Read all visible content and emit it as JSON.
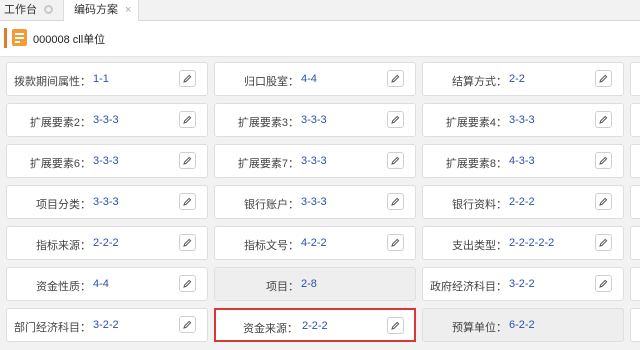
{
  "tabs": [
    {
      "label": "工作台"
    },
    {
      "label": "编码方案",
      "close": "×"
    }
  ],
  "header": {
    "title": "000008 cll单位"
  },
  "rows": [
    [
      {
        "label": "拨款期间属性：",
        "value": "1-1",
        "editable": true
      },
      {
        "label": "归口股室：",
        "value": "4-4",
        "editable": true
      },
      {
        "label": "结算方式：",
        "value": "2-2",
        "editable": true
      }
    ],
    [
      {
        "label": "扩展要素2：",
        "value": "3-3-3",
        "editable": true
      },
      {
        "label": "扩展要素3：",
        "value": "3-3-3",
        "editable": true
      },
      {
        "label": "扩展要素4：",
        "value": "3-3-3",
        "editable": true
      }
    ],
    [
      {
        "label": "扩展要素6：",
        "value": "3-3-3",
        "editable": true
      },
      {
        "label": "扩展要素7：",
        "value": "3-3-3",
        "editable": true
      },
      {
        "label": "扩展要素8：",
        "value": "4-3-3",
        "editable": true
      }
    ],
    [
      {
        "label": "项目分类：",
        "value": "3-3-3",
        "editable": true
      },
      {
        "label": "银行账户：",
        "value": "3-3-3",
        "editable": true
      },
      {
        "label": "银行资料：",
        "value": "2-2-2",
        "editable": true
      }
    ],
    [
      {
        "label": "指标来源：",
        "value": "2-2-2",
        "editable": true
      },
      {
        "label": "指标文号：",
        "value": "4-2-2",
        "editable": true
      },
      {
        "label": "支出类型：",
        "value": "2-2-2-2-2",
        "editable": true
      }
    ],
    [
      {
        "label": "资金性质：",
        "value": "4-4",
        "editable": true
      },
      {
        "label": "项目：",
        "value": "2-8",
        "editable": false
      },
      {
        "label": "政府经济科目：",
        "value": "3-2-2",
        "editable": true
      }
    ],
    [
      {
        "label": "部门经济科目：",
        "value": "3-2-2",
        "editable": true
      },
      {
        "label": "资金来源：",
        "value": "2-2-2",
        "editable": true,
        "highlighted": true
      },
      {
        "label": "预算单位：",
        "value": "6-2-2",
        "editable": false
      }
    ]
  ]
}
